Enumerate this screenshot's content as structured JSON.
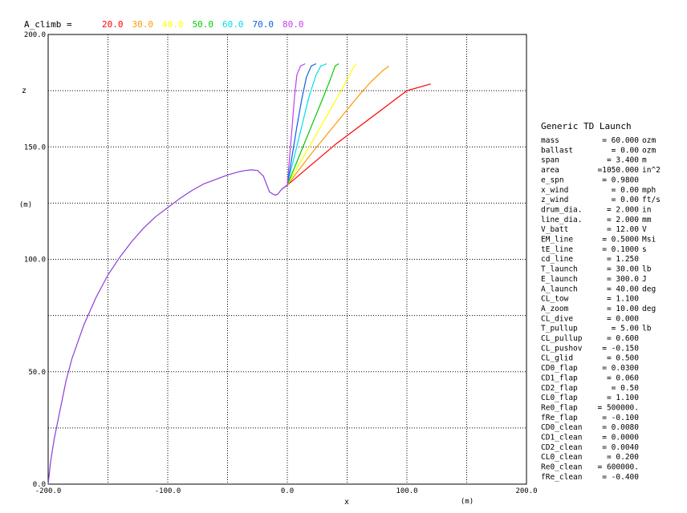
{
  "chart_data": {
    "type": "line",
    "legend_label": "A_climb =",
    "xlabel": "x",
    "xunit": "(m)",
    "ylabel": "z",
    "yunit": "(m)",
    "xlim": [
      -200,
      200
    ],
    "ylim": [
      0,
      200
    ],
    "x_ticks": [
      "-200.0",
      "-100.0",
      "0.0",
      "100.0",
      "200.0"
    ],
    "y_ticks": [
      "0.0",
      "50.0",
      "100.0",
      "150.0",
      "200.0"
    ],
    "grid": true,
    "legend_position": "top",
    "launch_path": {
      "color": "#8a3fd6",
      "x": [
        -200,
        -198,
        -195,
        -190,
        -185,
        -180,
        -170,
        -160,
        -150,
        -140,
        -130,
        -120,
        -110,
        -100,
        -90,
        -80,
        -70,
        -60,
        -50,
        -40,
        -35,
        -30,
        -25,
        -20,
        -15,
        -12,
        -10,
        -8,
        -5
      ],
      "y": [
        0,
        10,
        20,
        33,
        46,
        56,
        71,
        83,
        93,
        101,
        108,
        114,
        119,
        123,
        127,
        130.5,
        133.5,
        135.5,
        137.5,
        139,
        139.5,
        139.8,
        139.5,
        137,
        130,
        129,
        128.5,
        129,
        131
      ]
    },
    "series": [
      {
        "name": "20.0",
        "color": "#ff0000",
        "x": [
          -5,
          0,
          20,
          40,
          60,
          80,
          100,
          120
        ],
        "y": [
          131,
          133,
          142,
          151,
          159,
          167,
          175,
          178
        ]
      },
      {
        "name": "30.0",
        "color": "#ff9900",
        "x": [
          -5,
          0,
          20,
          40,
          60,
          70,
          80,
          85
        ],
        "y": [
          131,
          133,
          147,
          160,
          173,
          179,
          184,
          186
        ]
      },
      {
        "name": "40.0",
        "color": "#ffff00",
        "x": [
          -5,
          0,
          15,
          30,
          45,
          52,
          56,
          58
        ],
        "y": [
          131,
          133,
          147,
          161,
          175,
          182,
          186,
          187
        ]
      },
      {
        "name": "50.0",
        "color": "#00cc00",
        "x": [
          -5,
          0,
          10,
          20,
          30,
          36,
          40,
          43
        ],
        "y": [
          131,
          133,
          146,
          159,
          172,
          180,
          186,
          187
        ]
      },
      {
        "name": "60.0",
        "color": "#00ddee",
        "x": [
          -5,
          0,
          6,
          12,
          18,
          24,
          28,
          33
        ],
        "y": [
          131,
          133,
          146,
          159,
          172,
          182,
          186,
          187
        ]
      },
      {
        "name": "70.0",
        "color": "#1060e0",
        "x": [
          -5,
          0,
          4,
          8,
          12,
          16,
          20,
          24
        ],
        "y": [
          131,
          133,
          146,
          159,
          171,
          181,
          186,
          187
        ]
      },
      {
        "name": "80.0",
        "color": "#c040ee",
        "x": [
          -5,
          0,
          2,
          4,
          6,
          8,
          11,
          15
        ],
        "y": [
          131,
          133,
          146,
          159,
          172,
          182,
          186,
          187
        ]
      }
    ]
  },
  "params_panel": {
    "title": "Generic TD Launch",
    "rows": [
      {
        "name": "mass",
        "value": "60.000",
        "unit": "ozm"
      },
      {
        "name": "ballast",
        "value": "0.00",
        "unit": "ozm"
      },
      {
        "name": "span",
        "value": "3.400",
        "unit": "m"
      },
      {
        "name": "area",
        "value": "=1050.000",
        "unit": "in^2"
      },
      {
        "name": "e_spn",
        "value": "0.9800",
        "unit": ""
      },
      {
        "name": "x_wind",
        "value": "0.00",
        "unit": "mph"
      },
      {
        "name": "z_wind",
        "value": "0.00",
        "unit": "ft/s"
      },
      {
        "name": "drum_dia.",
        "value": "2.000",
        "unit": "in"
      },
      {
        "name": "line_dia.",
        "value": "2.000",
        "unit": "mm"
      },
      {
        "name": "V_batt",
        "value": "12.00",
        "unit": "V"
      },
      {
        "name": "EM_line",
        "value": "0.5000",
        "unit": "Msi"
      },
      {
        "name": "tE_line",
        "value": "0.1000",
        "unit": "s"
      },
      {
        "name": "cd_line",
        "value": "1.250",
        "unit": ""
      },
      {
        "name": "T_launch",
        "value": "30.00",
        "unit": "lb"
      },
      {
        "name": "E_launch",
        "value": "300.0",
        "unit": "J"
      },
      {
        "name": "A_launch",
        "value": "40.00",
        "unit": "deg"
      },
      {
        "name": "CL_tow",
        "value": "1.100",
        "unit": ""
      },
      {
        "name": "A_zoom",
        "value": "10.00",
        "unit": "deg"
      },
      {
        "name": "CL_dive",
        "value": "0.000",
        "unit": ""
      },
      {
        "name": "T_pullup",
        "value": "5.00",
        "unit": "lb"
      },
      {
        "name": "CL_pullup",
        "value": "0.600",
        "unit": ""
      },
      {
        "name": "CL_pushov",
        "value": "-0.150",
        "unit": ""
      },
      {
        "name": "CL_glid",
        "value": "0.500",
        "unit": ""
      },
      {
        "name": "CD0_flap",
        "value": "0.0300",
        "unit": ""
      },
      {
        "name": "CD1_flap",
        "value": "0.060",
        "unit": ""
      },
      {
        "name": "CD2_flap",
        "value": "0.50",
        "unit": ""
      },
      {
        "name": "CL0_flap",
        "value": "1.100",
        "unit": ""
      },
      {
        "name": "Re0_flap",
        "value": "500000.",
        "unit": ""
      },
      {
        "name": "fRe_flap",
        "value": "-0.100",
        "unit": ""
      },
      {
        "name": "CD0_clean",
        "value": "0.0080",
        "unit": ""
      },
      {
        "name": "CD1_clean",
        "value": "0.0000",
        "unit": ""
      },
      {
        "name": "CD2_clean",
        "value": "0.0040",
        "unit": ""
      },
      {
        "name": "CL0_clean",
        "value": "0.200",
        "unit": ""
      },
      {
        "name": "Re0_clean",
        "value": "600000.",
        "unit": ""
      },
      {
        "name": "fRe_clean",
        "value": "-0.400",
        "unit": ""
      }
    ]
  }
}
